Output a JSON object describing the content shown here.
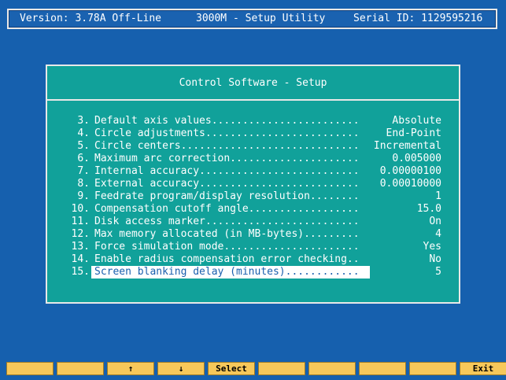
{
  "header": {
    "version": "Version: 3.78A Off-Line",
    "title": "3000M - Setup Utility",
    "serial": "Serial ID: 1129595216"
  },
  "dialog": {
    "title": "Control Software - Setup",
    "rows": [
      {
        "num": "3.",
        "label": "Default axis values........................",
        "value": "Absolute"
      },
      {
        "num": "4.",
        "label": "Circle adjustments.........................",
        "value": "End-Point"
      },
      {
        "num": "5.",
        "label": "Circle centers.............................",
        "value": "Incremental"
      },
      {
        "num": "6.",
        "label": "Maximum arc correction.....................",
        "value": "0.005000"
      },
      {
        "num": "7.",
        "label": "Internal accuracy..........................",
        "value": "0.00000100"
      },
      {
        "num": "8.",
        "label": "External accuracy..........................",
        "value": "0.00010000"
      },
      {
        "num": "9.",
        "label": "Feedrate program/display resolution........",
        "value": "1"
      },
      {
        "num": "10.",
        "label": "Compensation cutoff angle..................",
        "value": "15.0"
      },
      {
        "num": "11.",
        "label": "Disk access marker.........................",
        "value": "On"
      },
      {
        "num": "12.",
        "label": "Max memory allocated (in MB-bytes).........",
        "value": "4"
      },
      {
        "num": "13.",
        "label": "Force simulation mode......................",
        "value": "Yes"
      },
      {
        "num": "14.",
        "label": "Enable radius compensation error checking..",
        "value": "No"
      },
      {
        "num": "15.",
        "label": "Screen blanking delay (minutes)............",
        "value": "5"
      }
    ],
    "selected_index": 12
  },
  "fkeys": [
    "",
    "",
    "↑",
    "↓",
    "Select",
    "",
    "",
    "",
    "",
    "Exit"
  ],
  "colors": {
    "background": "#1660ae",
    "dialog": "#11a19a",
    "fkey": "#f7c85a",
    "selection": "#ffffff"
  }
}
